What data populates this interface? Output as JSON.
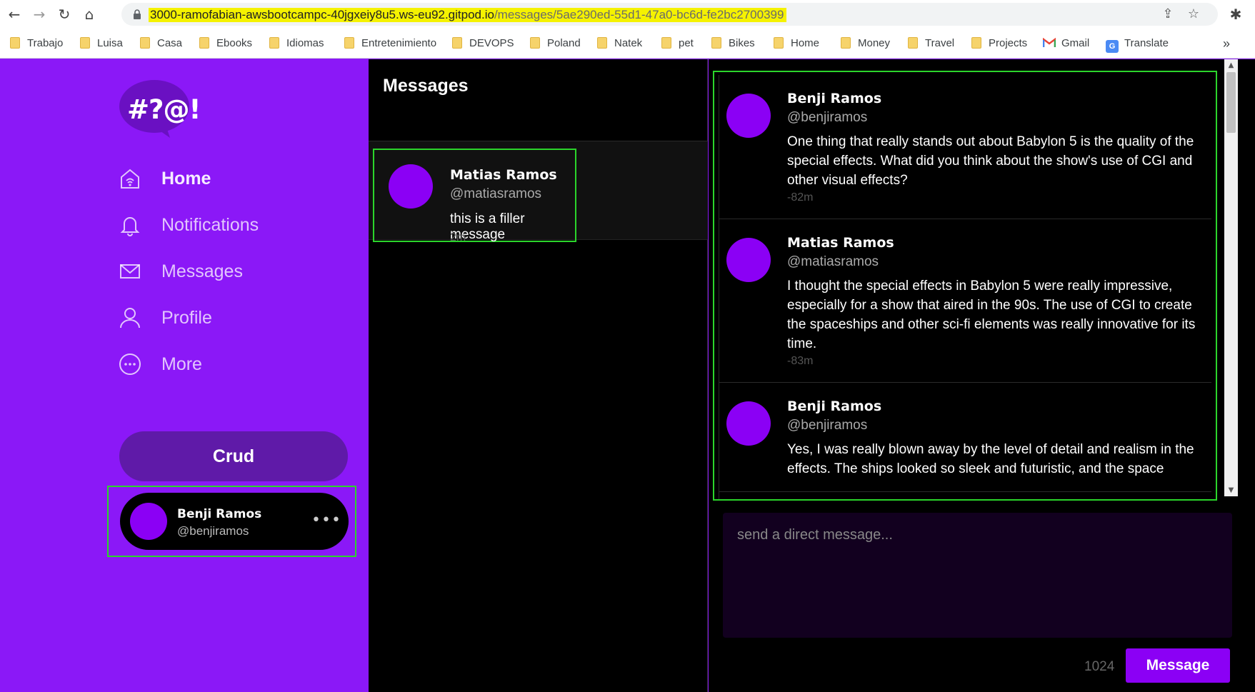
{
  "browser": {
    "url_host": "3000-ramofabian-awsbootcampc-40jgxeiy8u5.ws-eu92.gitpod.io",
    "url_path": "/messages/5ae290ed-55d1-47a0-bc6d-fe2bc2700399",
    "nav": {
      "back": "←",
      "forward": "→",
      "reload": "↻",
      "home": "⌂"
    },
    "omni_icons": {
      "share": "⇪",
      "star": "☆"
    },
    "extensions_icon": "✱",
    "bookmarks": [
      "Trabajo",
      "Luisa",
      "Casa",
      "Ebooks",
      "Idiomas",
      "Entretenimiento",
      "DEVOPS",
      "Poland",
      "Natek",
      "pet",
      "Bikes",
      "Home",
      "Money",
      "Travel",
      "Projects",
      "Gmail",
      "Translate"
    ],
    "bookmarks_more": "»",
    "translate_glyph": "G"
  },
  "sidebar": {
    "logo_text": "#?@!",
    "nav": [
      {
        "label": "Home",
        "icon": "home-icon"
      },
      {
        "label": "Notifications",
        "icon": "bell-icon"
      },
      {
        "label": "Messages",
        "icon": "envelope-icon"
      },
      {
        "label": "Profile",
        "icon": "user-icon"
      },
      {
        "label": "More",
        "icon": "more-circle-icon"
      }
    ],
    "active": "Home",
    "crud_label": "Crud",
    "profile": {
      "name": "Benji Ramos",
      "handle": "@benjiramos",
      "more": "•••"
    }
  },
  "groups": {
    "title": "Messages",
    "items": [
      {
        "name": "Matias Ramos",
        "handle": "@matiasramos",
        "text": "this is a filler message",
        "time": "2m"
      }
    ]
  },
  "conversation": {
    "messages": [
      {
        "name": "Benji Ramos",
        "handle": "@benjiramos",
        "text": "One thing that really stands out about Babylon 5 is the quality of the special effects. What did you think about the show's use of CGI and other visual effects?",
        "time": "-82m"
      },
      {
        "name": "Matias Ramos",
        "handle": "@matiasramos",
        "text": "I thought the special effects in Babylon 5 were really impressive, especially for a show that aired in the 90s. The use of CGI to create the spaceships and other sci-fi elements was really innovative for its time.",
        "time": "-83m"
      },
      {
        "name": "Benji Ramos",
        "handle": "@benjiramos",
        "text": "Yes, I was really blown away by the level of detail and realism in the effects. The ships looked so sleek and futuristic, and the space",
        "time": ""
      }
    ],
    "compose_placeholder": "send a direct message...",
    "char_count": "1024",
    "send_label": "Message"
  },
  "colors": {
    "brand": "#8b18f7",
    "avatar": "#8b00f5",
    "crud": "#5f1aa8",
    "highlight": "#2bd52b",
    "url_highlight": "#f5f200"
  }
}
